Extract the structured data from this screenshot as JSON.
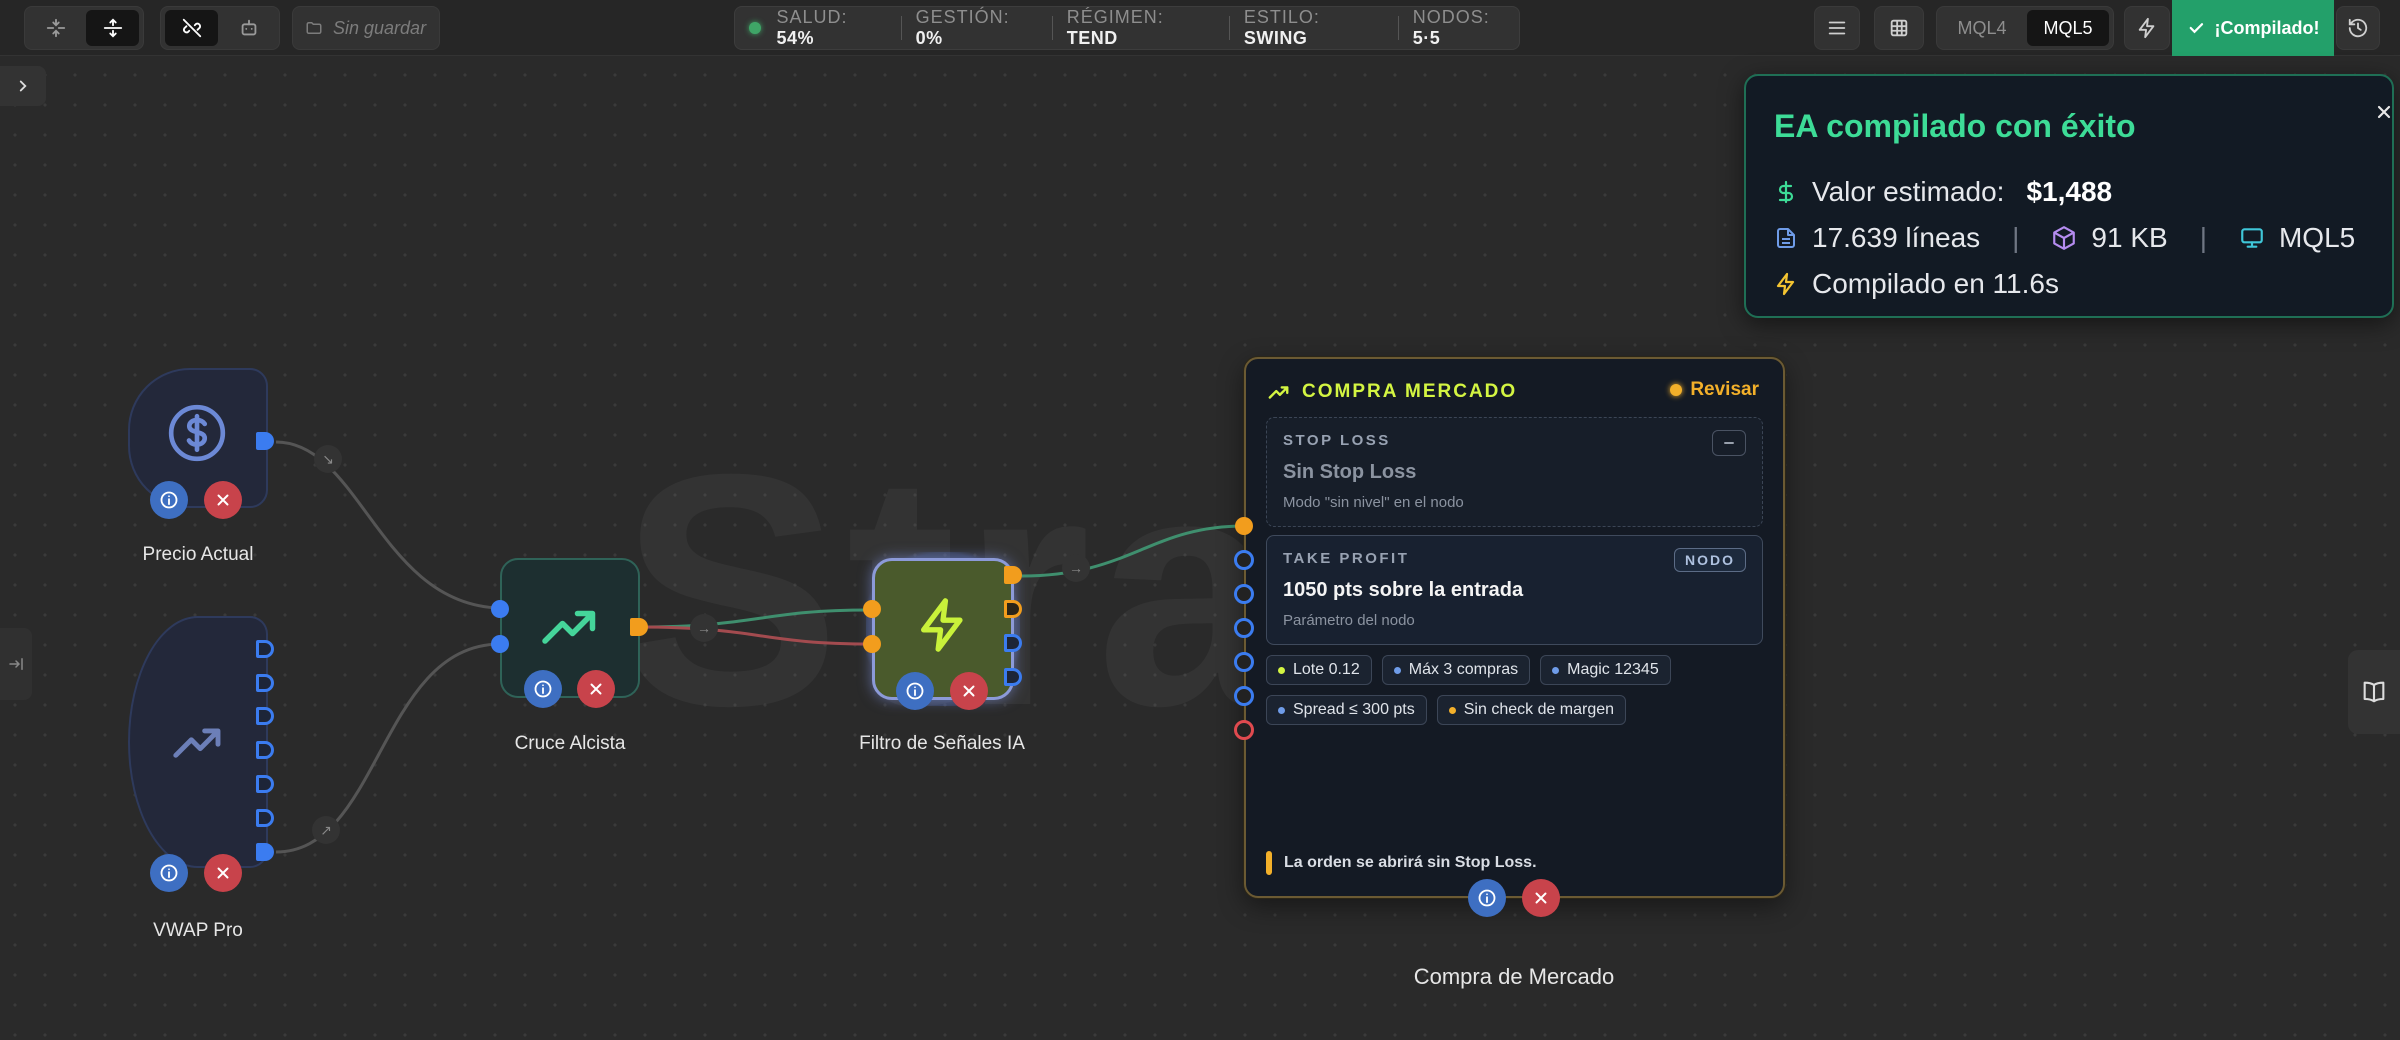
{
  "toolbar": {
    "unsaved_label": "Sin guardar",
    "status": {
      "salud_label": "SALUD:",
      "salud_value": "54%",
      "gestion_label": "GESTIÓN:",
      "gestion_value": "0%",
      "regimen_label": "RÉGIMEN:",
      "regimen_value": "TEND",
      "estilo_label": "ESTILO:",
      "estilo_value": "SWING",
      "nodos_label": "NODOS:",
      "nodos_value": "5·5"
    },
    "mql4_label": "MQL4",
    "mql5_label": "MQL5",
    "compiled_label": "¡Compilado!"
  },
  "canvas": {
    "watermark": "Stra"
  },
  "nodes": {
    "precio_actual": {
      "label": "Precio Actual"
    },
    "vwap_pro": {
      "label": "VWAP Pro"
    },
    "cruce_alcista": {
      "label": "Cruce Alcista"
    },
    "filtro_senales": {
      "label": "Filtro de Señales IA"
    },
    "compra_mercado": {
      "label": "Compra de Mercado",
      "header": "COMPRA MERCADO",
      "status": "Revisar",
      "stop_loss": {
        "label": "STOP LOSS",
        "value": "Sin Stop Loss",
        "sub": "Modo \"sin nivel\" en el nodo"
      },
      "take_profit": {
        "label": "TAKE PROFIT",
        "badge": "NODO",
        "value": "1050 pts sobre la entrada",
        "sub": "Parámetro del nodo"
      },
      "chips": [
        "Lote 0.12",
        "Máx 3 compras",
        "Magic 12345",
        "Spread ≤ 300 pts",
        "Sin check de margen"
      ],
      "warning": "La orden se abrirá sin Stop Loss."
    }
  },
  "toast": {
    "title": "EA compilado con éxito",
    "value_label": "Valor estimado:",
    "value": "$1,488",
    "lines": "17.639 líneas",
    "size": "91 KB",
    "target": "MQL5",
    "time": "Compilado en 11.6s"
  },
  "colors": {
    "accent_green": "#23a06a",
    "success_text": "#3ddc97",
    "handle_blue": "#3b7cf0",
    "handle_orange": "#f29d1d",
    "warning": "#f3b02a",
    "lime": "#d4f542",
    "danger": "#c8434b"
  }
}
